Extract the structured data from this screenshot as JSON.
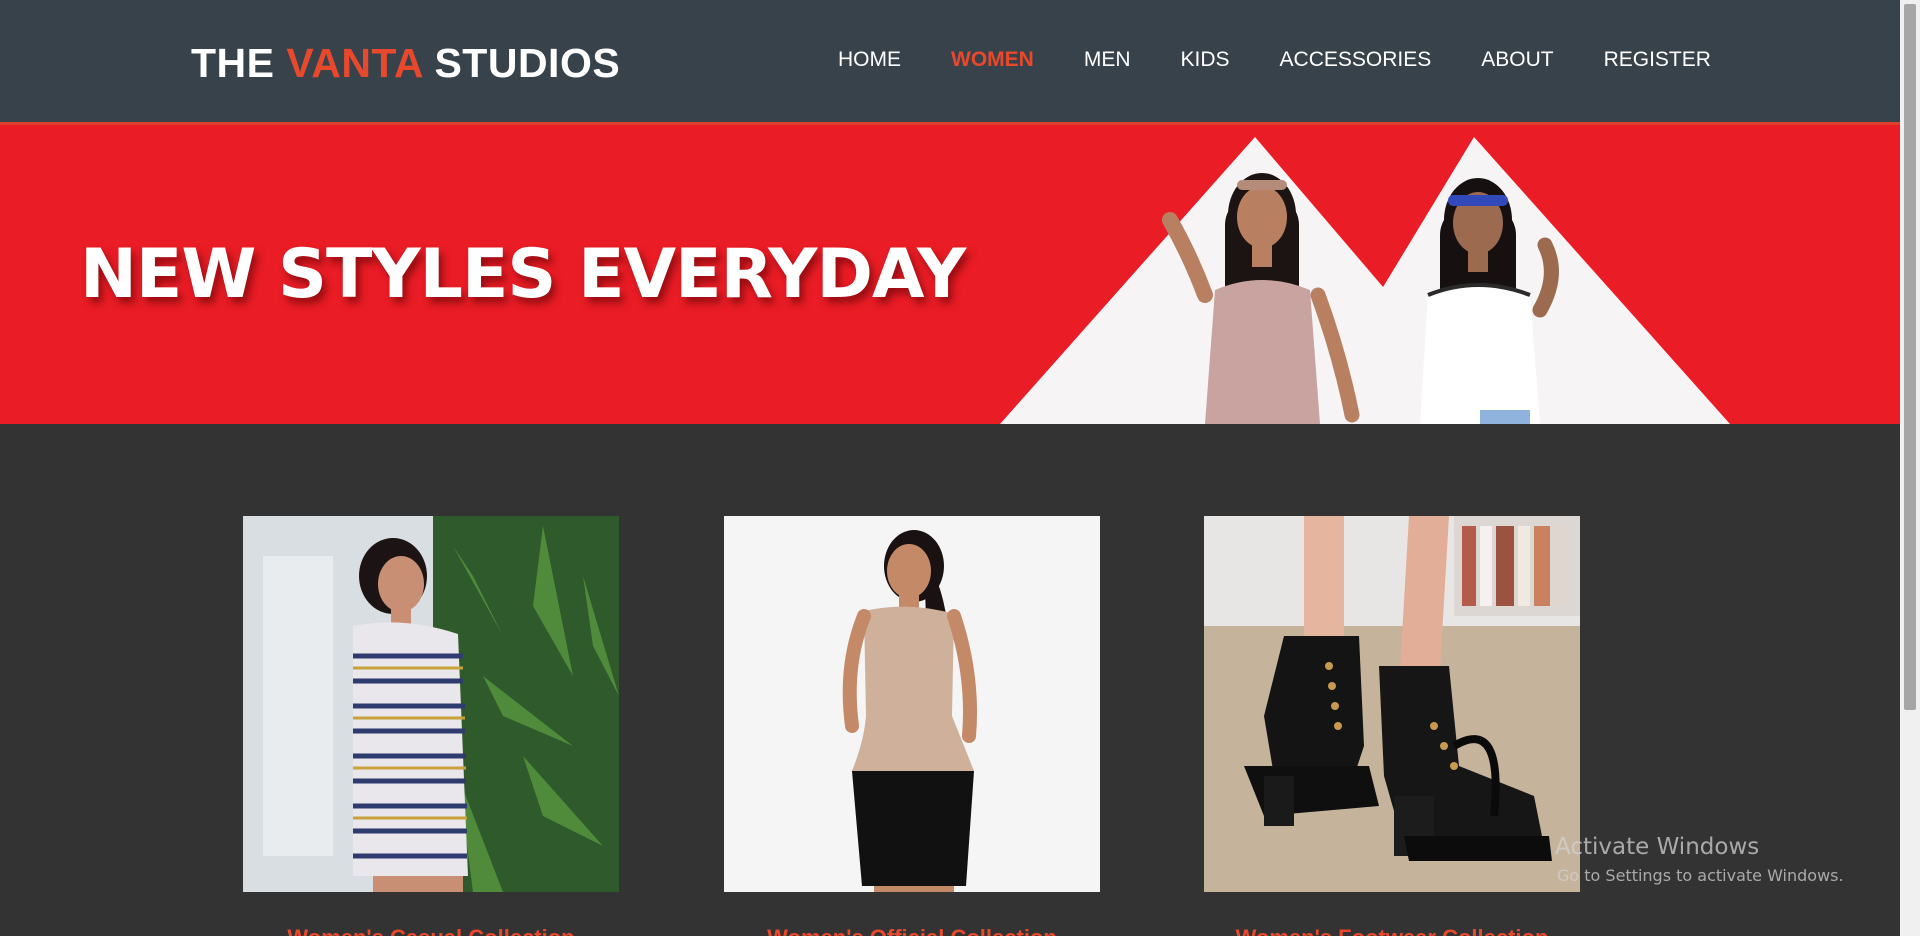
{
  "header": {
    "logo": {
      "part1": "THE",
      "accent": "VANTA",
      "part2": "STUDIOS"
    },
    "nav": [
      {
        "label": "HOME"
      },
      {
        "label": "WOMEN"
      },
      {
        "label": "MEN"
      },
      {
        "label": "KIDS"
      },
      {
        "label": "ACCESSORIES"
      },
      {
        "label": "ABOUT"
      },
      {
        "label": "REGISTER"
      }
    ],
    "active_nav": "WOMEN"
  },
  "banner": {
    "title": "NEW STYLES EVERYDAY"
  },
  "products": [
    {
      "caption": "Women's Casual Collection",
      "image": "woman-striped-dress-photo"
    },
    {
      "caption": "Women's Official Collection",
      "image": "woman-office-wear-photo"
    },
    {
      "caption": "Women's Footwear Collection",
      "image": "black-ankle-boots-photo"
    }
  ],
  "watermark": {
    "line1": "Activate Windows",
    "line2": "Go to Settings to activate Windows."
  },
  "colors": {
    "header_bg": "#37424a",
    "accent": "#e8492c",
    "banner_bg": "#ea1c25",
    "page_bg": "#333333"
  }
}
